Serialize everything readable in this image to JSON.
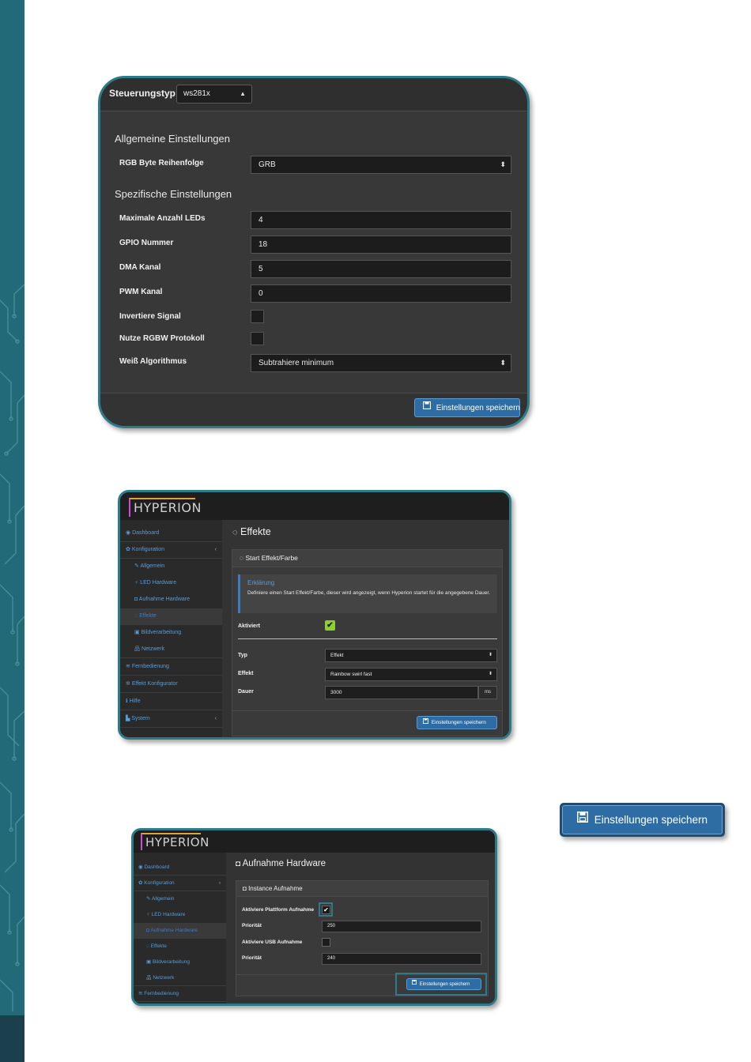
{
  "panel_device": {
    "controller_label": "Steuerungstyp:",
    "controller_value": "ws281x",
    "general_title": "Allgemeine Einstellungen",
    "rgb_order_label": "RGB Byte Reihenfolge",
    "rgb_order_value": "GRB",
    "specific_title": "Spezifische Einstellungen",
    "fields": [
      {
        "label": "Maximale Anzahl LEDs",
        "value": "4"
      },
      {
        "label": "GPIO Nummer",
        "value": "18"
      },
      {
        "label": "DMA Kanal",
        "value": "5"
      },
      {
        "label": "PWM Kanal",
        "value": "0"
      }
    ],
    "invert_label": "Invertiere Signal",
    "rgbw_label": "Nutze RGBW Protokoll",
    "white_algo_label": "Weiß Algorithmus",
    "white_algo_value": "Subtrahiere minimum",
    "save_label": "Einstellungen speichern"
  },
  "panel_effects": {
    "logo": "HYPERION",
    "sidebar": [
      {
        "label": "Dashboard"
      },
      {
        "label": "Konfiguration"
      },
      {
        "label": "Allgemein"
      },
      {
        "label": "LED Hardware"
      },
      {
        "label": "Aufnahme Hardware"
      },
      {
        "label": "Effekte"
      },
      {
        "label": "Bildverarbeitung"
      },
      {
        "label": "Netzwerk"
      },
      {
        "label": "Fernbedienung"
      },
      {
        "label": "Effekt Konfigurator"
      },
      {
        "label": "Hilfe"
      },
      {
        "label": "System"
      }
    ],
    "page_title": "Effekte",
    "box_title": "Start Effekt/Farbe",
    "callout_title": "Erklärung",
    "callout_text": "Definiere einen Start Effekt/Farbe, dieser wird angezeigt, wenn Hyperion startet für die angegebene Dauer.",
    "enabled_label": "Aktiviert",
    "type_label": "Typ",
    "type_value": "Effekt",
    "effect_label": "Effekt",
    "effect_value": "Rainbow swirl fast",
    "duration_label": "Dauer",
    "duration_value": "3000",
    "duration_unit": "ms",
    "save_label": "Einstellungen speichern"
  },
  "standalone_button": {
    "label": "Einstellungen speichern"
  },
  "panel_capture": {
    "logo": "HYPERION",
    "sidebar": [
      {
        "label": "Dashboard"
      },
      {
        "label": "Konfiguration"
      },
      {
        "label": "Allgemein"
      },
      {
        "label": "LED Hardware"
      },
      {
        "label": "Aufnahme Hardware"
      },
      {
        "label": "Effekte"
      },
      {
        "label": "Bildverarbeitung"
      },
      {
        "label": "Netzwerk"
      },
      {
        "label": "Fernbedienung"
      }
    ],
    "page_title": "Aufnahme Hardware",
    "box_title": "Instance Aufnahme",
    "platform_label": "Aktiviere Plattform Aufnahme",
    "priority1_label": "Priorität",
    "priority1_value": "250",
    "usb_label": "Aktiviere USB Aufnahme",
    "priority2_label": "Priorität",
    "priority2_value": "240",
    "save_label": "Einstellungen speichern"
  },
  "colors": {
    "teal_frame": "#2e7a88",
    "save_button": "#2e6da4",
    "link_blue": "#5b9bd5",
    "checkbox_green": "#8fce2f",
    "side_strip": "#236a79"
  }
}
